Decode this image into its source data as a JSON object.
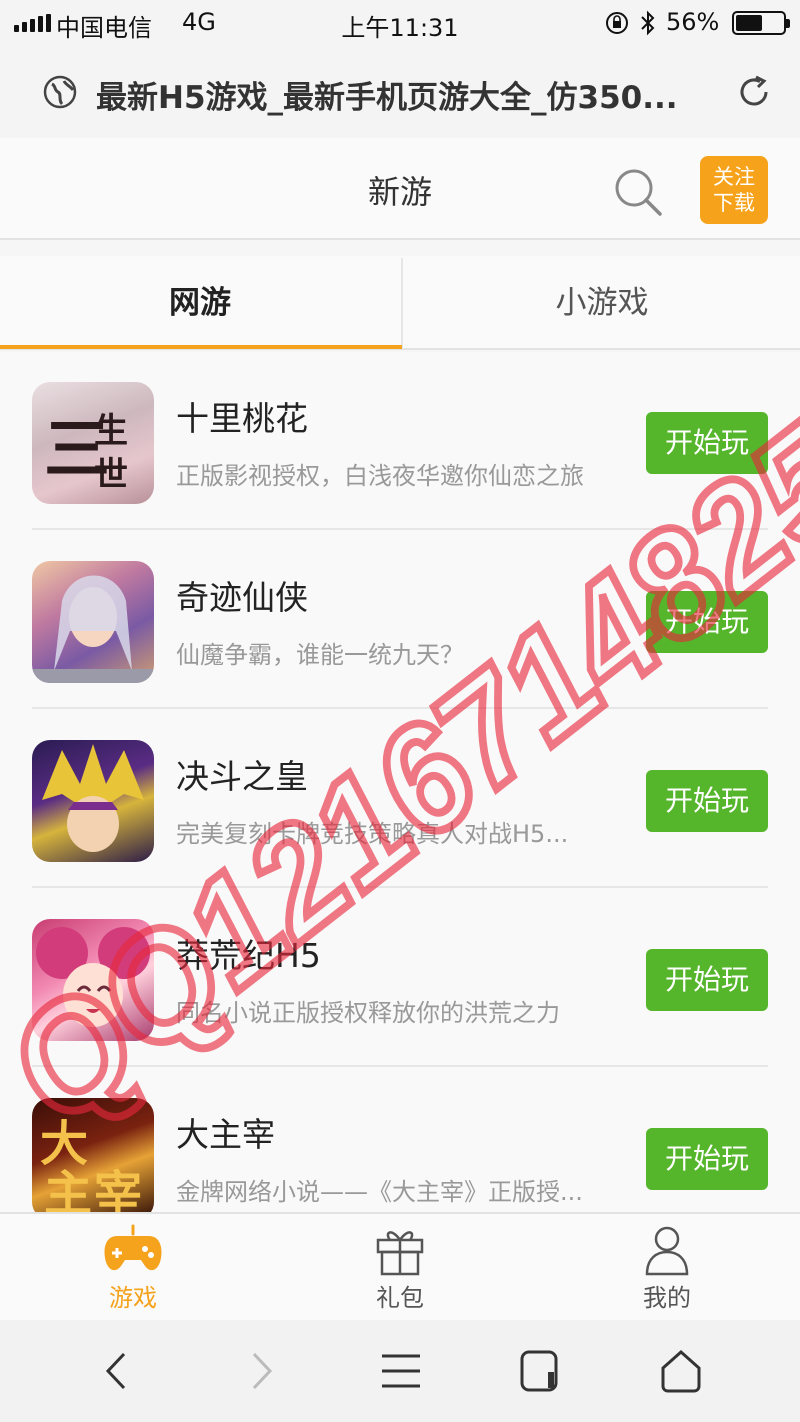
{
  "status_bar": {
    "carrier": "中国电信",
    "network": "4G",
    "time": "上午11:31",
    "battery_percent": "56%",
    "battery_level": 0.56
  },
  "url_bar": {
    "title": "最新H5游戏_最新手机页游大全_仿350..."
  },
  "header": {
    "title": "新游",
    "follow_line1": "关注",
    "follow_line2": "下载"
  },
  "tabs": [
    {
      "label": "网游",
      "active": true
    },
    {
      "label": "小游戏",
      "active": false
    }
  ],
  "games": [
    {
      "name": "十里桃花",
      "desc": "正版影视授权，白浅夜华邀你仙恋之旅",
      "button": "开始玩",
      "icon": "game-icon-sanshengsanshi"
    },
    {
      "name": "奇迹仙侠",
      "desc": "仙魔争霸，谁能一统九天？",
      "button": "开始玩",
      "icon": "game-icon-qijixianxia"
    },
    {
      "name": "决斗之皇",
      "desc": "完美复刻卡牌竞技策略真人对战H5...",
      "button": "开始玩",
      "icon": "game-icon-juedouzhihuang"
    },
    {
      "name": "莽荒纪H5",
      "desc": "同名小说正版授权释放你的洪荒之力",
      "button": "开始玩",
      "icon": "game-icon-manghuangji"
    },
    {
      "name": "大主宰",
      "desc": "金牌网络小说——《大主宰》正版授...",
      "button": "开始玩",
      "icon": "game-icon-dazhuzai"
    }
  ],
  "bottom_nav": [
    {
      "label": "游戏",
      "icon": "gamepad-icon",
      "active": true
    },
    {
      "label": "礼包",
      "icon": "gift-icon",
      "active": false
    },
    {
      "label": "我的",
      "icon": "user-icon",
      "active": false
    }
  ],
  "watermark": "QQ1216714825",
  "colors": {
    "accent": "#f5a21c",
    "play_button": "#55b52b",
    "watermark": "#e8283c"
  }
}
